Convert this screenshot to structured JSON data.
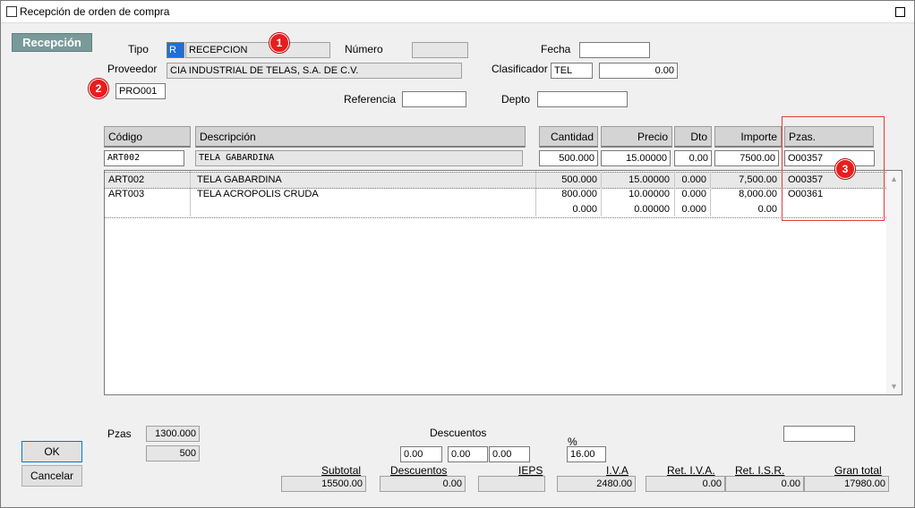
{
  "window": {
    "title": "Recepción de orden de compra"
  },
  "tab": {
    "label": "Recepción"
  },
  "header": {
    "tipo_label": "Tipo",
    "tipo_code": "R",
    "tipo_desc": "RECEPCION",
    "numero_label": "Número",
    "numero_value": "",
    "fecha_label": "Fecha",
    "fecha_value": "",
    "proveedor_label": "Proveedor",
    "proveedor_name": "CIA INDUSTRIAL DE TELAS, S.A. DE C.V.",
    "proveedor_code": "PRO001",
    "clasificador_label": "Clasificador",
    "clasificador_code": "TEL",
    "clasificador_value": "0.00",
    "referencia_label": "Referencia",
    "referencia_value": "",
    "depto_label": "Depto",
    "depto_value": ""
  },
  "columns": {
    "codigo": "Código",
    "descripcion": "Descripción",
    "cantidad": "Cantidad",
    "precio": "Precio",
    "dto": "Dto",
    "importe": "Importe",
    "pzas": "Pzas."
  },
  "entry": {
    "codigo": "ART002",
    "descripcion": "TELA GABARDINA",
    "cantidad": "500.000",
    "precio": "15.00000",
    "dto": "0.00",
    "importe": "7500.00",
    "pzas": "O00357"
  },
  "rows": [
    {
      "codigo": "ART002",
      "descripcion": "TELA GABARDINA",
      "cantidad": "500.000",
      "precio": "15.00000",
      "dto": "0.000",
      "importe": "7,500.00",
      "pzas": "O00357"
    },
    {
      "codigo": "ART003",
      "descripcion": "TELA ACROPOLIS CRUDA",
      "cantidad": "800.000",
      "precio": "10.00000",
      "dto": "0.000",
      "importe": "8,000.00",
      "pzas": "O00361"
    },
    {
      "codigo": "",
      "descripcion": "",
      "cantidad": "0.000",
      "precio": "0.00000",
      "dto": "0.000",
      "importe": "0.00",
      "pzas": ""
    }
  ],
  "footer": {
    "pzas_label": "Pzas",
    "pzas_total": "1300.000",
    "pzas_count": "500",
    "descuentos_label": "Descuentos",
    "desc1": "0.00",
    "desc2": "0.00",
    "desc3": "0.00",
    "pct_label": "%",
    "pct_value": "16.00",
    "extra_field": "",
    "subtotal_label": "Subtotal",
    "subtotal": "15500.00",
    "descuentos_total_label": "Descuentos",
    "descuentos_total": "0.00",
    "ieps_label": "IEPS",
    "ieps": "",
    "iva_label": "I.V.A",
    "iva": "2480.00",
    "ret_iva_label": "Ret. I.V.A.",
    "ret_iva": "0.00",
    "ret_isr_label": "Ret. I.S.R.",
    "ret_isr": "0.00",
    "gran_total_label": "Gran total",
    "gran_total": "17980.00"
  },
  "buttons": {
    "ok": "OK",
    "cancel": "Cancelar"
  },
  "badges": [
    "1",
    "2",
    "3"
  ],
  "colors": {
    "badge": "#e81e1e",
    "tab": "#7a9a9a",
    "highlight_box": "#e23b3b",
    "selection": "#1e6fd9"
  },
  "icons": {
    "window": "window-icon",
    "maximize": "maximize-icon"
  }
}
